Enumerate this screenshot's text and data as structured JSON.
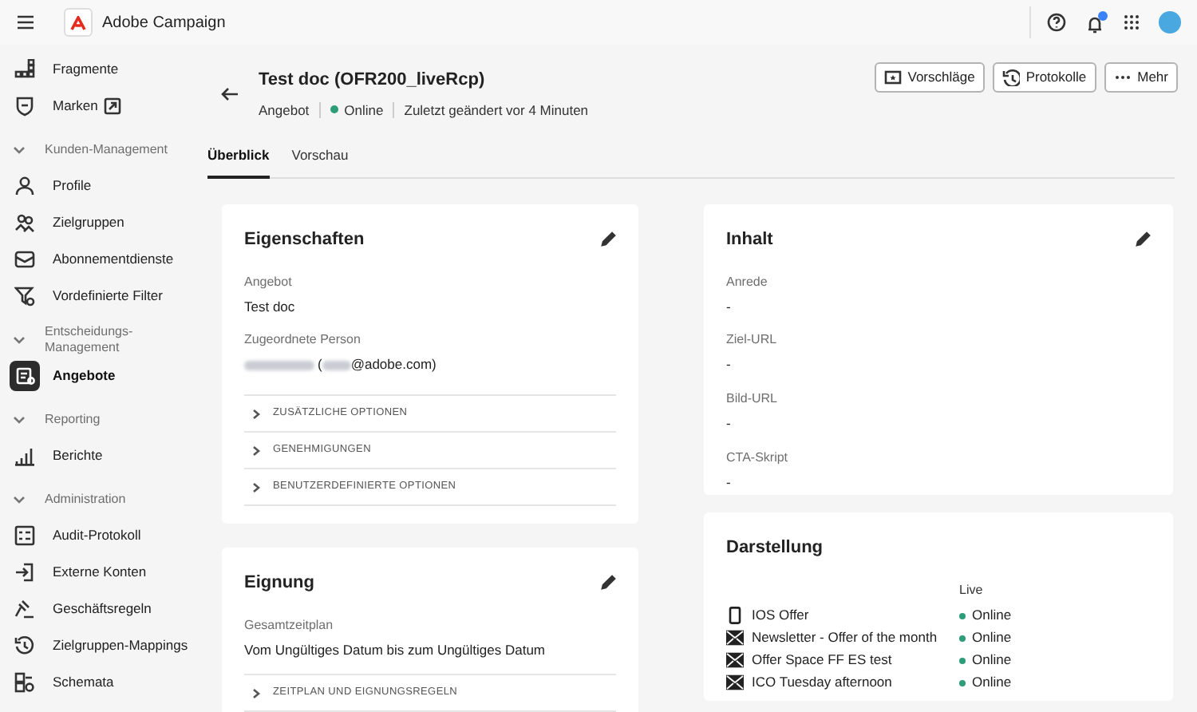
{
  "top_bar": {
    "app_name": "Adobe Campaign",
    "notifications": true
  },
  "sidebar": {
    "items": [
      {
        "kind": "item",
        "label": "Fragmente",
        "selected": false
      },
      {
        "kind": "item",
        "label": "Marken",
        "selected": false
      },
      {
        "kind": "section",
        "label": "Kunden-Management",
        "expanded": true
      },
      {
        "kind": "item",
        "label": "Profile",
        "selected": false
      },
      {
        "kind": "item",
        "label": "Zielgruppen",
        "selected": false
      },
      {
        "kind": "item",
        "label": "Abonnementdienste",
        "selected": false
      },
      {
        "kind": "item",
        "label": "Vordefinierte Filter",
        "selected": false
      },
      {
        "kind": "section",
        "label": "Entscheidungs-Management",
        "expanded": true
      },
      {
        "kind": "item",
        "label": "Angebote",
        "selected": true
      },
      {
        "kind": "section",
        "label": "Reporting",
        "expanded": true
      },
      {
        "kind": "item",
        "label": "Berichte",
        "selected": false
      },
      {
        "kind": "section",
        "label": "Administration",
        "expanded": true
      },
      {
        "kind": "item",
        "label": "Audit-Protokoll",
        "selected": false
      },
      {
        "kind": "item",
        "label": "Externe Konten",
        "selected": false
      },
      {
        "kind": "item",
        "label": "Geschäftsregeln",
        "selected": false
      },
      {
        "kind": "item",
        "label": "Zielgruppen-Mappings",
        "selected": false
      },
      {
        "kind": "item",
        "label": "Schemata",
        "selected": false
      }
    ]
  },
  "header": {
    "title": "Test doc (OFR200_liveRcp)",
    "type": "Angebot",
    "status": "Online",
    "modified": "Zuletzt geändert vor 4 Minuten",
    "buttons": [
      {
        "label": "Vorschläge"
      },
      {
        "label": "Protokolle"
      },
      {
        "label": "Mehr"
      }
    ]
  },
  "tabs": [
    {
      "label": "Überblick",
      "selected": true
    },
    {
      "label": "Vorschau",
      "selected": false
    }
  ],
  "properties_card": {
    "title": "Eigenschaften",
    "fields": [
      {
        "label": "Angebot",
        "value": "Test doc"
      }
    ],
    "assigned_person": {
      "label": "Zugeordnete Person",
      "value_start": "(",
      "value_end": "@adobe.com)"
    },
    "sections": [
      {
        "label": "ZUSÄTZLICHE OPTIONEN",
        "expanded": false
      },
      {
        "label": "GENEHMIGUNGEN",
        "expanded": false
      },
      {
        "label": "BENUTZERDEFINIERTE OPTIONEN",
        "expanded": false
      }
    ]
  },
  "eligibility_card": {
    "title": "Eignung",
    "fields": [
      {
        "label": "Gesamtzeitplan",
        "value": "Vom Ungültiges Datum bis zum Ungültiges Datum"
      }
    ],
    "sections": [
      {
        "label": "ZEITPLAN UND EIGNUNGSREGELN",
        "expanded": false
      }
    ]
  },
  "content_card": {
    "title": "Inhalt",
    "fields": [
      {
        "label": "Anrede",
        "value": "-"
      },
      {
        "label": "Ziel-URL",
        "value": "-"
      },
      {
        "label": "Bild-URL",
        "value": "-"
      },
      {
        "label": "CTA-Skript",
        "value": "-"
      }
    ]
  },
  "representation_card": {
    "title": "Darstellung",
    "column": "Live",
    "rows": [
      {
        "kind": "mobile",
        "name": "IOS Offer",
        "status": "Online"
      },
      {
        "kind": "email",
        "name": "Newsletter - Offer of the month",
        "status": "Online"
      },
      {
        "kind": "email",
        "name": "Offer Space FF ES test",
        "status": "Online"
      },
      {
        "kind": "email",
        "name": "ICO Tuesday afternoon",
        "status": "Online"
      }
    ]
  }
}
